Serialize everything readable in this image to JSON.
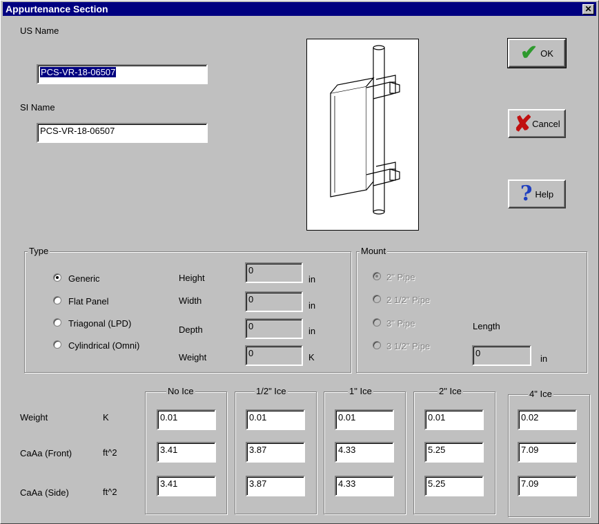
{
  "window": {
    "title": "Appurtenance Section",
    "close_glyph": "✕"
  },
  "names": {
    "us_label": "US Name",
    "us_value": "PCS-VR-18-06507",
    "si_label": "SI Name",
    "si_value": "PCS-VR-18-06507"
  },
  "buttons": {
    "ok": "OK",
    "cancel": "Cancel",
    "help": "Help"
  },
  "type_group": {
    "legend": "Type",
    "options": [
      "Generic",
      "Flat Panel",
      "Triagonal (LPD)",
      "Cylindrical (Omni)"
    ],
    "selected": "Generic",
    "dims": [
      {
        "label": "Height",
        "value": "0",
        "unit": "in"
      },
      {
        "label": "Width",
        "value": "0",
        "unit": "in"
      },
      {
        "label": "Depth",
        "value": "0",
        "unit": "in"
      },
      {
        "label": "Weight",
        "value": "0",
        "unit": "K"
      }
    ]
  },
  "mount_group": {
    "legend": "Mount",
    "options": [
      "2\" Pipe",
      "2 1/2\" Pipe",
      "3\" Pipe",
      "3 1/2\" Pipe"
    ],
    "selected": "2\" Pipe",
    "length_label": "Length",
    "length_value": "0",
    "length_unit": "in"
  },
  "ice_table": {
    "rows": [
      {
        "label": "Weight",
        "unit": "K"
      },
      {
        "label": "CaAa (Front)",
        "unit": "ft^2"
      },
      {
        "label": "CaAa (Side)",
        "unit": "ft^2"
      }
    ],
    "columns": [
      {
        "header": "No Ice",
        "values": [
          "0.01",
          "3.41",
          "3.41"
        ]
      },
      {
        "header": "1/2\" Ice",
        "values": [
          "0.01",
          "3.87",
          "3.87"
        ]
      },
      {
        "header": "1\" Ice",
        "values": [
          "0.01",
          "4.33",
          "4.33"
        ]
      },
      {
        "header": "2\" Ice",
        "values": [
          "0.01",
          "5.25",
          "5.25"
        ]
      },
      {
        "header": "4\" Ice",
        "values": [
          "0.02",
          "7.09",
          "7.09"
        ]
      }
    ]
  },
  "colors": {
    "titlebar": "#000080",
    "face": "#c0c0c0",
    "ok_check": "#2e9a2e",
    "cancel_x": "#c01010",
    "help_q": "#1f3fbf"
  }
}
